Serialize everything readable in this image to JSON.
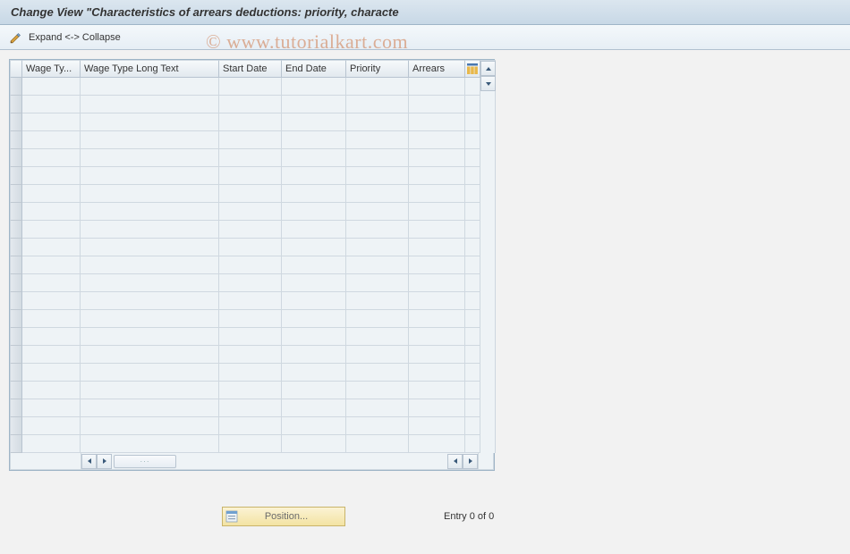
{
  "title": "Change View \"Characteristics of arrears deductions: priority, characte",
  "toolbar": {
    "pencil_icon": "pencil-icon",
    "expand_collapse_label": "Expand <-> Collapse"
  },
  "table": {
    "columns": [
      "Wage Ty...",
      "Wage Type Long Text",
      "Start Date",
      "End Date",
      "Priority",
      "Arrears"
    ],
    "config_icon": "table-settings-icon",
    "row_count": 21
  },
  "footer": {
    "position_label": "Position...",
    "entry_text": "Entry 0 of 0"
  },
  "watermark": "© www.tutorialkart.com"
}
